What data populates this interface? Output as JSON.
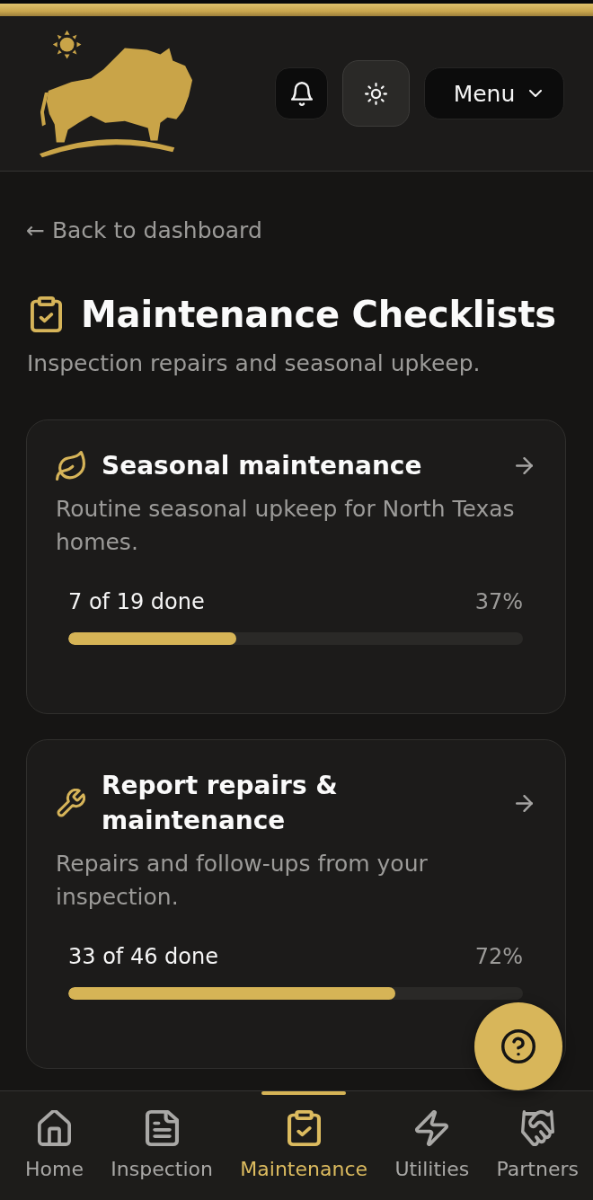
{
  "header": {
    "menu_label": "Menu"
  },
  "back_link": "← Back to dashboard",
  "page": {
    "title": "Maintenance Checklists",
    "subtitle": "Inspection repairs and seasonal upkeep."
  },
  "checklists": [
    {
      "kind": "seasonal",
      "title": "Seasonal maintenance",
      "description": "Routine seasonal upkeep for North Texas homes.",
      "progress_label": "7 of 19 done",
      "percent": "37%",
      "level": 0.37
    },
    {
      "kind": "repairs",
      "title": "Report repairs & maintenance",
      "description": "Repairs and follow-ups from your inspection.",
      "progress_label": "33 of 46 done",
      "percent": "72%",
      "level": 0.72
    }
  ],
  "bottom_nav": [
    {
      "kind": "home",
      "label": "Home",
      "selected": false
    },
    {
      "kind": "inspection",
      "label": "Inspection",
      "selected": false
    },
    {
      "kind": "maintenance",
      "label": "Maintenance",
      "selected": true
    },
    {
      "kind": "utilities",
      "label": "Utilities",
      "selected": false
    },
    {
      "kind": "partners",
      "label": "Partners",
      "selected": false
    }
  ]
}
